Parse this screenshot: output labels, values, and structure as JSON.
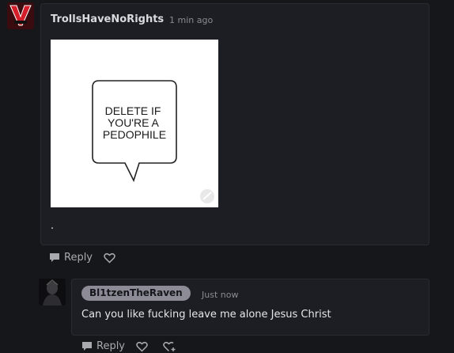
{
  "comments": [
    {
      "username": "TrollsHaveNoRights",
      "timestamp": "1 min ago",
      "image_text": "DELETE IF YOU'RE A PEDOPHILE",
      "body": ".",
      "reply_label": "Reply"
    },
    {
      "username": "Bl1tzenTheRaven",
      "timestamp": "Just now",
      "body": "Can you like fucking leave me alone Jesus Christ",
      "reply_label": "Reply"
    }
  ],
  "icons": {
    "reply": "speech-bubble-icon",
    "like": "heart-icon",
    "react": "heart-plus-icon",
    "expand": "expand-icon"
  },
  "colors": {
    "background": "#16171b",
    "card": "#1d1e23",
    "badge": "#8c8b96"
  }
}
